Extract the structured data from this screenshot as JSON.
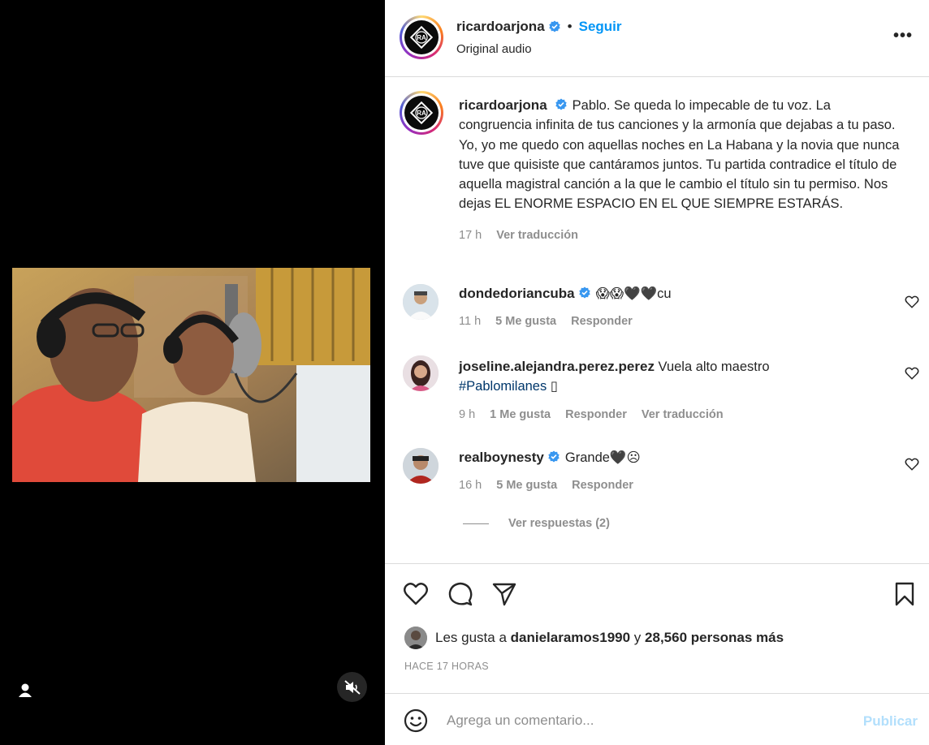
{
  "post": {
    "username": "ricardoarjona",
    "follow_label": "Seguir",
    "dot": "•",
    "subtitle": "Original audio",
    "more_label": "•••",
    "avatar_logo": "RA"
  },
  "caption": {
    "username": "ricardoarjona",
    "text": "Pablo. Se queda lo impecable de tu voz. La congruencia infinita de tus canciones y la armonía que dejabas a tu paso. Yo, yo me quedo con aquellas noches en La Habana y la novia que nunca tuve que quisiste que cantáramos juntos. Tu partida contradice el título de aquella magistral canción a la que le cambio el título sin tu permiso. Nos dejas EL ENORME ESPACIO EN EL QUE SIEMPRE ESTARÁS.",
    "time": "17 h",
    "translate_label": "Ver traducción"
  },
  "comments": [
    {
      "username": "dondedoriancuba",
      "verified": true,
      "text": "😱😱🖤🖤cu",
      "time": "11 h",
      "likes": "5 Me gusta",
      "reply_label": "Responder"
    },
    {
      "username": "joseline.alejandra.perez.perez",
      "verified": false,
      "text": "Vuela alto maestro",
      "hashtag": "#Pablomilanes",
      "trailing": "▯",
      "time": "9 h",
      "likes": "1 Me gusta",
      "reply_label": "Responder",
      "translate_label": "Ver traducción"
    },
    {
      "username": "realboynesty",
      "verified": true,
      "text": "Grande🖤☹",
      "time": "16 h",
      "likes": "5 Me gusta",
      "reply_label": "Responder",
      "replies_label": "Ver respuestas (2)"
    }
  ],
  "likes": {
    "prefix": "Les gusta a",
    "user": "danielaramos1990",
    "conj": "y",
    "others": "28,560 personas más"
  },
  "time_ago": "HACE 17 HORAS",
  "add_comment": {
    "placeholder": "Agrega un comentario...",
    "publish_label": "Publicar"
  },
  "colors": {
    "accent": "#0095f6",
    "publish_disabled": "#b2dffc",
    "muted": "#8e8e8e",
    "verified": "#3897f0"
  },
  "icons": {
    "verified": "verified-badge-icon",
    "more": "more-options-icon",
    "like": "heart-icon",
    "comment": "comment-bubble-icon",
    "share": "paper-plane-icon",
    "save": "bookmark-icon",
    "emoji": "emoji-smiley-icon",
    "tag": "tagged-user-icon",
    "mute": "speaker-muted-icon"
  }
}
